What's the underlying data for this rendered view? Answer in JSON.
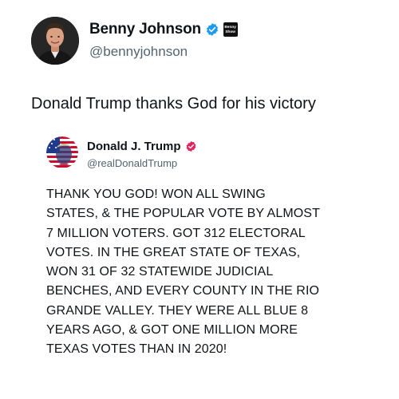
{
  "post": {
    "author": {
      "display_name": "Benny Johnson",
      "handle": "@bennyjohnson",
      "avatar_icon": "user-avatar-photo",
      "verified": true,
      "verified_color": "#1d9bf0",
      "affiliation_badge_text": [
        "Benny",
        "Show"
      ]
    },
    "text": "Donald Trump thanks God for his victory"
  },
  "quoted_post": {
    "author": {
      "display_name": "Donald J. Trump",
      "handle": "@realDonaldTrump",
      "avatar_icon": "flag-portrait-avatar",
      "verified": true,
      "verified_color": "#e0245e"
    },
    "text_lines": [
      "THANK YOU GOD! WON ALL SWING",
      "STATES, & THE POPULAR VOTE BY ALMOST",
      "7 MILLION VOTERS. GOT 312 ELECTORAL",
      "VOTES. IN THE GREAT STATE OF TEXAS,",
      "WON 31 OF 32 STATEWIDE JUDICIAL",
      "BENCHES, AND EVERY COUNTY IN THE RIO",
      "GRANDE VALLEY. THEY WERE ALL BLUE 8",
      "YEARS AGO, & GOT ONE MILLION MORE",
      "TEXAS VOTES THAN IN 2020!"
    ]
  }
}
